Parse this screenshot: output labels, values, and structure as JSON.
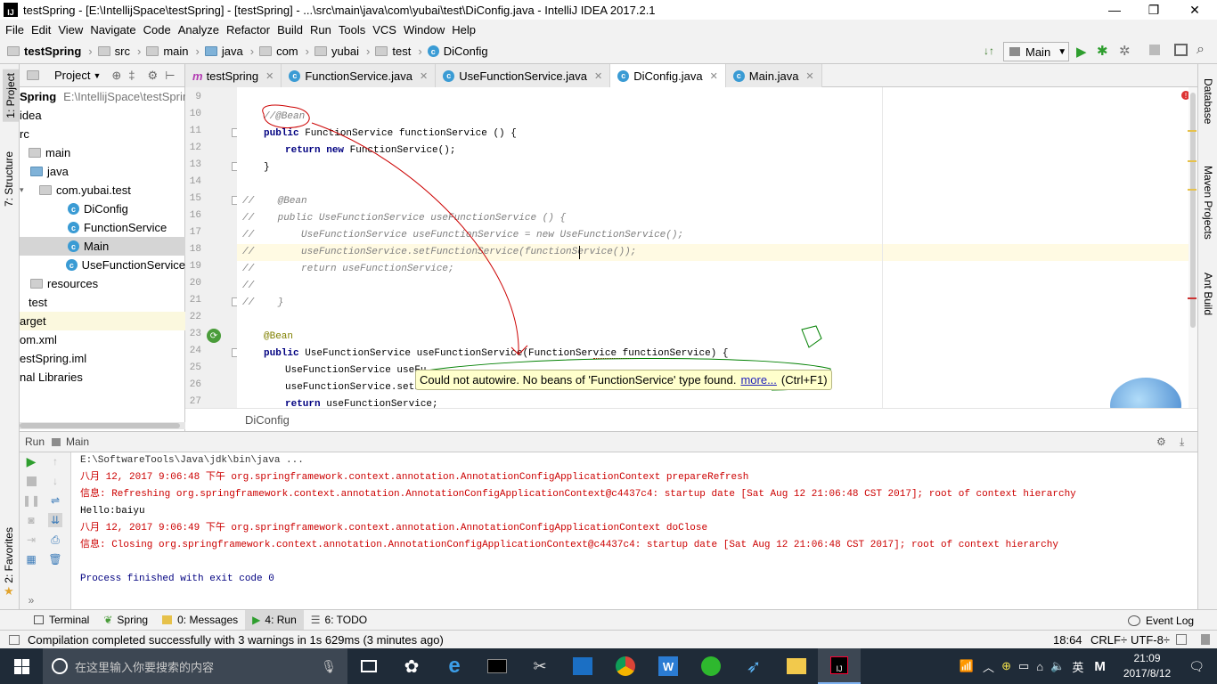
{
  "window": {
    "title": "testSpring - [E:\\IntellijSpace\\testSpring] - [testSpring] - ...\\src\\main\\java\\com\\yubai\\test\\DiConfig.java - IntelliJ IDEA 2017.2.1",
    "minimize": "—",
    "maximize": "❐",
    "close": "✕"
  },
  "menu": [
    "File",
    "Edit",
    "View",
    "Navigate",
    "Code",
    "Analyze",
    "Refactor",
    "Build",
    "Run",
    "Tools",
    "VCS",
    "Window",
    "Help"
  ],
  "breadcrumb": [
    "testSpring",
    "src",
    "main",
    "java",
    "com",
    "yubai",
    "test",
    "DiConfig"
  ],
  "toolbar": {
    "run_config": "Main"
  },
  "left_tool_tabs": {
    "project": "1: Project",
    "structure": "7: Structure",
    "favorites": "2: Favorites"
  },
  "right_tool_tabs": {
    "database": "Database",
    "maven": "Maven Projects",
    "ant": "Ant Build"
  },
  "project_panel": {
    "header": "Project",
    "items": [
      {
        "label": "Spring",
        "extra": "E:\\IntellijSpace\\testSpring",
        "bold": true
      },
      {
        "label": "idea"
      },
      {
        "label": "rc"
      },
      {
        "label": "main"
      },
      {
        "label": "java"
      },
      {
        "label": "com.yubai.test"
      },
      {
        "label": "DiConfig"
      },
      {
        "label": "FunctionService"
      },
      {
        "label": "Main"
      },
      {
        "label": "UseFunctionService"
      },
      {
        "label": "resources"
      },
      {
        "label": "test"
      },
      {
        "label": "arget"
      },
      {
        "label": "om.xml"
      },
      {
        "label": "estSpring.iml"
      },
      {
        "label": "nal Libraries"
      }
    ]
  },
  "editor_tabs": [
    {
      "label": "testSpring",
      "icon": "m"
    },
    {
      "label": "FunctionService.java",
      "icon": "c"
    },
    {
      "label": "UseFunctionService.java",
      "icon": "c"
    },
    {
      "label": "DiConfig.java",
      "icon": "c",
      "active": true
    },
    {
      "label": "Main.java",
      "icon": "c"
    }
  ],
  "code": {
    "line_numbers": [
      "9",
      "10",
      "11",
      "12",
      "13",
      "14",
      "15",
      "16",
      "17",
      "18",
      "19",
      "20",
      "21",
      "22",
      "23",
      "24",
      "25",
      "26",
      "27"
    ],
    "l10": "//@Bean",
    "l11_kw": "public",
    "l11_rest": " FunctionService functionService () {",
    "l12_kw1": "return",
    "l12_kw2": "new",
    "l12_rest": " FunctionService();",
    "l13": "}",
    "l15": "//    @Bean",
    "l16": "//    public UseFunctionService useFunctionService () {",
    "l17": "//        UseFunctionService useFunctionService = new UseFunctionService();",
    "l18": "//        useFunctionService.setFunctionService(functionService());",
    "l19": "//        return useFunctionService;",
    "l20": "//",
    "l21": "//    }",
    "l23": "@Bean",
    "l24_kw": "public",
    "l24_rest": " UseFunctionService useFunctionService(FunctionService functionService) {",
    "l25": "UseFunctionService useFu",
    "l26": "useFunctionService.setFu",
    "l27_kw": "return",
    "l27_rest": " useFunctionService;"
  },
  "editor_breadcrumb": "DiConfig",
  "tooltip": {
    "text": "Could not autowire. No beans of 'FunctionService' type found.",
    "link": "more...",
    "shortcut": "(Ctrl+F1)"
  },
  "run_panel": {
    "header_run": "Run",
    "header_config": "Main",
    "lines": [
      "E:\\SoftwareTools\\Java\\jdk\\bin\\java ...",
      "八月 12, 2017 9:06:48 下午 org.springframework.context.annotation.AnnotationConfigApplicationContext prepareRefresh",
      "信息: Refreshing org.springframework.context.annotation.AnnotationConfigApplicationContext@c4437c4: startup date [Sat Aug 12 21:06:48 CST 2017]; root of context hierarchy",
      "Hello:baiyu",
      "八月 12, 2017 9:06:49 下午 org.springframework.context.annotation.AnnotationConfigApplicationContext doClose",
      "信息: Closing org.springframework.context.annotation.AnnotationConfigApplicationContext@c4437c4: startup date [Sat Aug 12 21:06:48 CST 2017]; root of context hierarchy",
      "",
      "Process finished with exit code 0"
    ]
  },
  "bottom_tabs": {
    "terminal": "Terminal",
    "spring": "Spring",
    "messages": "0: Messages",
    "run": "4: Run",
    "todo": "6: TODO",
    "event_log": "Event Log"
  },
  "status": {
    "message": "Compilation completed successfully with 3 warnings in 1s 629ms (3 minutes ago)",
    "position": "18:64",
    "line_sep": "CRLF÷",
    "encoding": "UTF-8÷"
  },
  "taskbar": {
    "search_placeholder": "在这里输入你要搜索的内容",
    "time": "21:09",
    "date": "2017/8/12",
    "ime": "英"
  },
  "colors": {
    "keyword": "#000080",
    "comment": "#808080",
    "annotation": "#808000",
    "error_red": "#cc0000",
    "string_green": "#008000"
  }
}
